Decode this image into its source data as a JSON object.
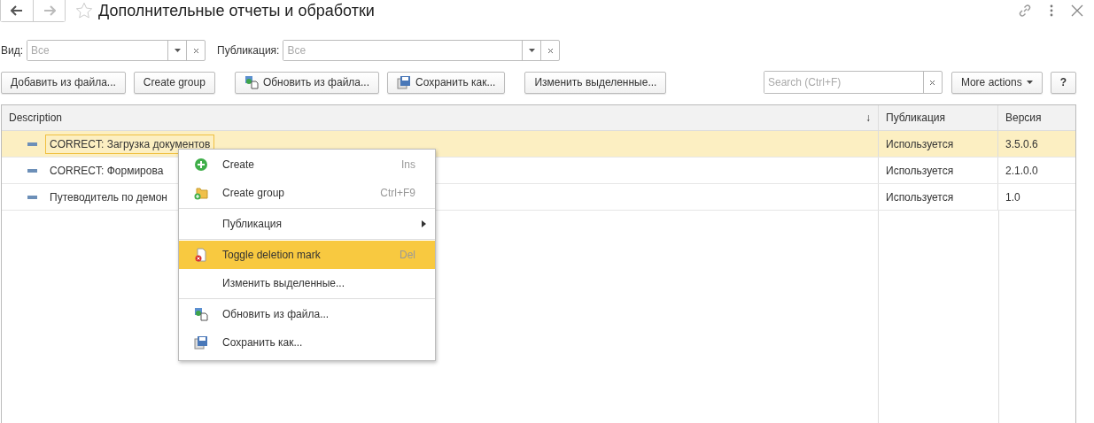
{
  "window": {
    "title": "Дополнительные отчеты и обработки"
  },
  "filters": [
    {
      "label": "Вид:",
      "placeholder": "Все"
    },
    {
      "label": "Публикация:",
      "placeholder": "Все"
    }
  ],
  "toolbar": [
    {
      "label": "Добавить из файла...",
      "kind": "plain"
    },
    {
      "label": "Create group",
      "kind": "plain"
    },
    {
      "label": "Обновить из файла...",
      "kind": "update"
    },
    {
      "label": "Сохранить как...",
      "kind": "save"
    },
    {
      "label": "Изменить выделенные...",
      "kind": "plain"
    }
  ],
  "search": {
    "placeholder": "Search (Ctrl+F)"
  },
  "more_actions": "More actions",
  "help": "?",
  "table": {
    "columns": [
      {
        "label": "Description",
        "sort": "↓"
      },
      {
        "label": "Публикация"
      },
      {
        "label": "Версия"
      }
    ],
    "rows": [
      {
        "selected": true,
        "cells": [
          "CORRECT: Загрузка документов",
          "Используется",
          "3.5.0.6"
        ]
      },
      {
        "selected": false,
        "cells": [
          "CORRECT: Формирова",
          "Используется",
          "2.1.0.0"
        ]
      },
      {
        "selected": false,
        "cells": [
          "Путеводитель по демон",
          "Используется",
          "1.0"
        ]
      }
    ]
  },
  "context_menu": {
    "groups": [
      [
        {
          "label": "Create",
          "kind": "create",
          "shortcut": "Ins",
          "submenu": false,
          "selected": false
        },
        {
          "label": "Create group",
          "kind": "folder",
          "shortcut": "Ctrl+F9",
          "submenu": false,
          "selected": false
        }
      ],
      [
        {
          "label": "Публикация",
          "kind": "plain",
          "submenu": true,
          "selected": false
        }
      ],
      [
        {
          "label": "Toggle deletion mark",
          "kind": "delete",
          "shortcut": "Del",
          "submenu": false,
          "selected": true
        },
        {
          "label": "Изменить выделенные...",
          "kind": "plain",
          "submenu": false,
          "selected": false
        }
      ],
      [
        {
          "label": "Обновить из файла...",
          "kind": "update",
          "submenu": false,
          "selected": false
        },
        {
          "label": "Сохранить как...",
          "kind": "save",
          "submenu": false,
          "selected": false
        }
      ]
    ]
  }
}
